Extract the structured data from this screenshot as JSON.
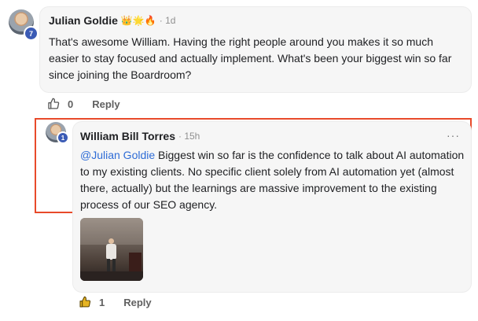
{
  "comment": {
    "author": "Julian Goldie",
    "badges": "👑🌟🔥",
    "time": "· 1d",
    "level": "7",
    "text": "That's awesome William. Having the right people around you makes it so much easier to stay focused and actually implement. What's been your biggest win so far since joining the Boardroom?",
    "likes": "0",
    "reply_label": "Reply"
  },
  "reply": {
    "author": "William Bill Torres",
    "time": "· 15h",
    "level": "1",
    "more": "···",
    "mention": "@Julian Goldie",
    "text": " Biggest win so far is the confidence to talk about AI automation to my existing clients. No specific client solely from AI automation yet (almost there, actually) but the learnings are massive improvement to the existing process of our SEO agency.",
    "likes": "1",
    "reply_label": "Reply"
  },
  "colors": {
    "highlight": "#e84a2a",
    "mention": "#2e6cd6",
    "level_badge": "#3b5bb5"
  },
  "icons": {
    "like": "thumbs-up-icon",
    "like_active": "thumbs-up-filled-icon",
    "more": "more-horizontal-icon"
  }
}
